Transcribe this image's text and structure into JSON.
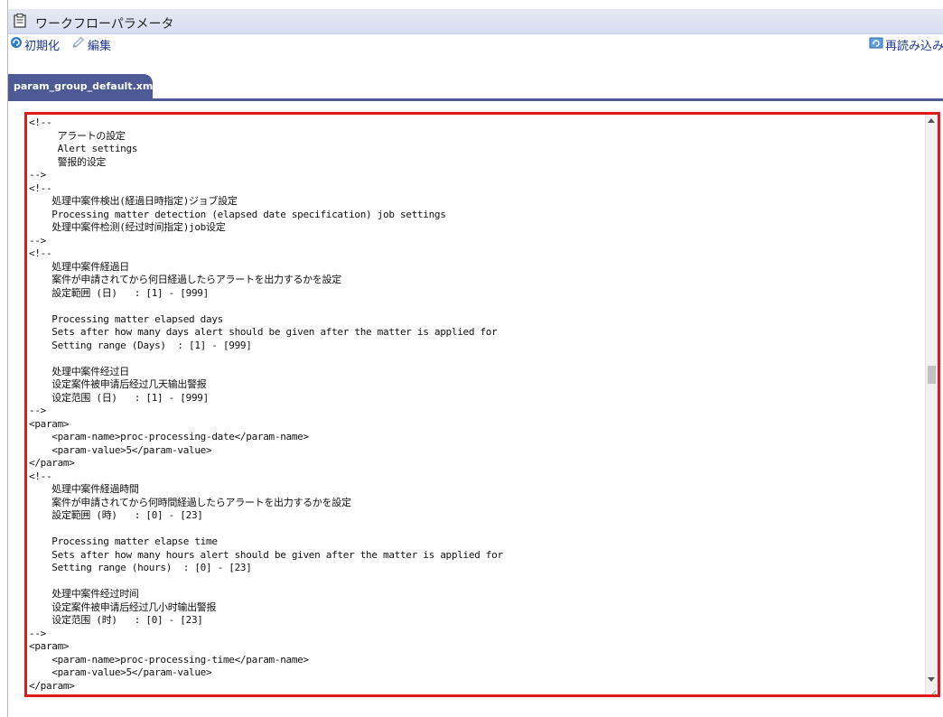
{
  "window": {
    "title": "ワークフローパラメータ",
    "icon": "clipboard-icon"
  },
  "toolbar": {
    "init_label": "初期化",
    "init_icon": "refresh-icon",
    "edit_label": "編集",
    "edit_icon": "pencil-icon",
    "reload_label": "再読み込み",
    "reload_icon": "reload-icon"
  },
  "tabs": [
    {
      "label": "param_group_default.xml",
      "active": true
    }
  ],
  "editor": {
    "content": "<!--\n     アラートの設定\n     Alert settings\n     警报的设定\n-->\n<!--\n    処理中案件検出(経過日時指定)ジョブ設定\n    Processing matter detection (elapsed date specification) job settings\n    处理中案件检测(经过时间指定)job设定\n-->\n<!--\n    処理中案件経過日\n    案件が申請されてから何日経過したらアラートを出力するかを設定\n    設定範囲 (日)   : [1] - [999]\n\n    Processing matter elapsed days\n    Sets after how many days alert should be given after the matter is applied for\n    Setting range (Days)  : [1] - [999]\n\n    处理中案件经过日\n    设定案件被申请后经过几天输出警报\n    设定范围 (日)   : [1] - [999]\n-->\n<param>\n    <param-name>proc-processing-date</param-name>\n    <param-value>5</param-value>\n</param>\n<!--\n    処理中案件経過時間\n    案件が申請されてから何時間経過したらアラートを出力するかを設定\n    設定範囲 (時)   : [0] - [23]\n\n    Processing matter elapse time\n    Sets after how many hours alert should be given after the matter is applied for\n    Setting range (hours)  : [0] - [23]\n\n    处理中案件经过时间\n    设定案件被申请后经过几小时输出警报\n    设定范围 (时)   : [0] - [23]\n-->\n<param>\n    <param-name>proc-processing-time</param-name>\n    <param-value>5</param-value>\n</param>"
  },
  "colors": {
    "highlight_border": "#e0171b",
    "tab_background": "#4d5a95",
    "link_text": "#1f3a93"
  }
}
